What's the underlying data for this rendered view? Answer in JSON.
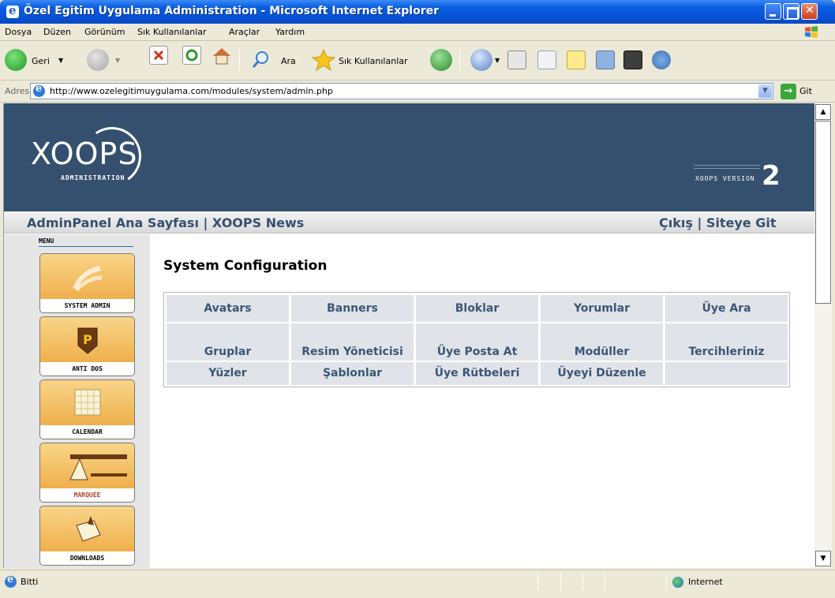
{
  "window": {
    "title": "Özel Egitim Uygulama Administration - Microsoft Internet Explorer"
  },
  "menubar": {
    "items": [
      "Dosya",
      "Düzen",
      "Görünüm",
      "Sık Kullanılanlar",
      "Araçlar",
      "Yardım"
    ]
  },
  "toolbar": {
    "back_label": "Geri",
    "search_label": "Ara",
    "favorites_label": "Sık Kullanılanlar"
  },
  "address": {
    "label": "Adres",
    "url": "http://www.ozelegitimuygulama.com/modules/system/admin.php",
    "go_label": "Git"
  },
  "header": {
    "logo_text": "XOOPS",
    "logo_sub": "ADMINISTRATION",
    "version_text": "XOOPS VERSION",
    "version_num": "2"
  },
  "nav": {
    "left": "AdminPanel Ana Sayfası | XOOPS News",
    "right": "Çıkış | Siteye Git"
  },
  "menu": {
    "label": "MENU",
    "modules": [
      {
        "name": "SYSTEM ADMIN"
      },
      {
        "name": "ANTI DOS"
      },
      {
        "name": "CALENDAR"
      },
      {
        "name": "MARQUEE"
      },
      {
        "name": "DOWNLOADS"
      }
    ]
  },
  "main": {
    "title": "System Configuration",
    "grid": [
      [
        "Avatars",
        "Banners",
        "Bloklar",
        "Yorumlar",
        "Üye Ara"
      ],
      [
        "Gruplar",
        "Resim Yöneticisi",
        "Üye Posta At",
        "Modüller",
        "Tercihleriniz"
      ],
      [
        "Yüzler",
        "Şablonlar",
        "Üye Rütbeleri",
        "Üyeyi Düzenle",
        ""
      ]
    ]
  },
  "status": {
    "text": "Bitti",
    "zone": "Internet"
  }
}
